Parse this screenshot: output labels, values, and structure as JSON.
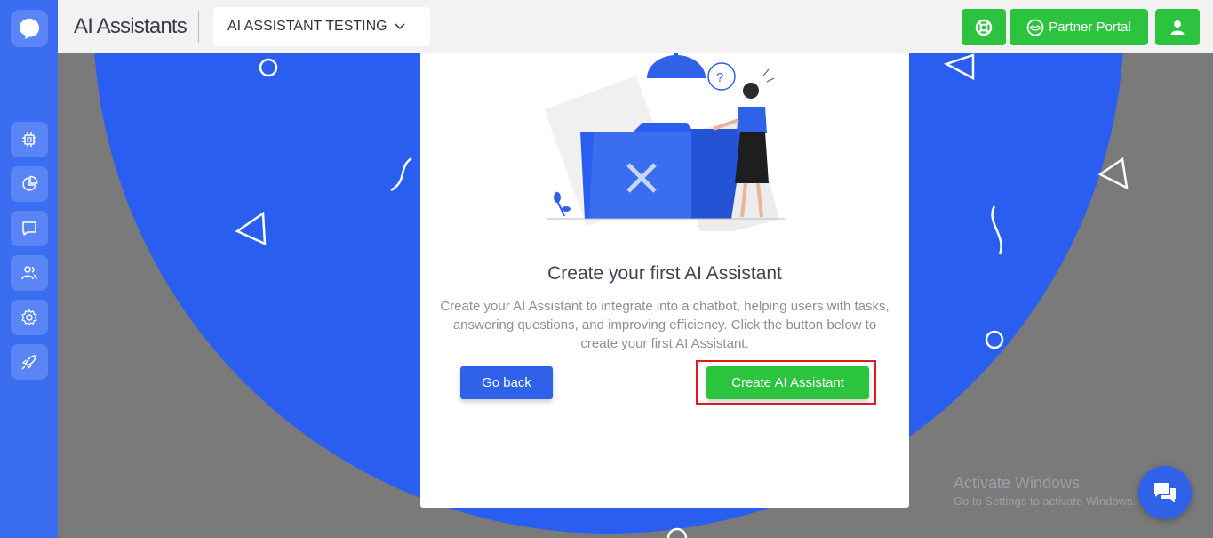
{
  "app": {
    "title": "AI Assistants"
  },
  "header": {
    "project_name": "AI ASSISTANT TESTING",
    "partner_portal_label": "Partner Portal"
  },
  "sidebar": {
    "items": [
      {
        "name": "chip-icon"
      },
      {
        "name": "pie-chart-icon"
      },
      {
        "name": "chat-icon"
      },
      {
        "name": "users-icon"
      },
      {
        "name": "gear-icon"
      },
      {
        "name": "rocket-icon"
      }
    ]
  },
  "empty_state": {
    "title": "Create your first AI Assistant",
    "description": "Create your AI Assistant to integrate into a chatbot, helping users with tasks, answering questions, and improving efficiency. Click the button below to create your first AI Assistant.",
    "back_label": "Go back",
    "create_label": "Create AI Assistant"
  },
  "watermark": {
    "line1": "Activate Windows",
    "line2": "Go to Settings to activate Windows."
  },
  "colors": {
    "sidebar": "#3b6df0",
    "accent_blue": "#2a5ef0",
    "green": "#2cc33f",
    "highlight_red": "#e11b1b"
  }
}
